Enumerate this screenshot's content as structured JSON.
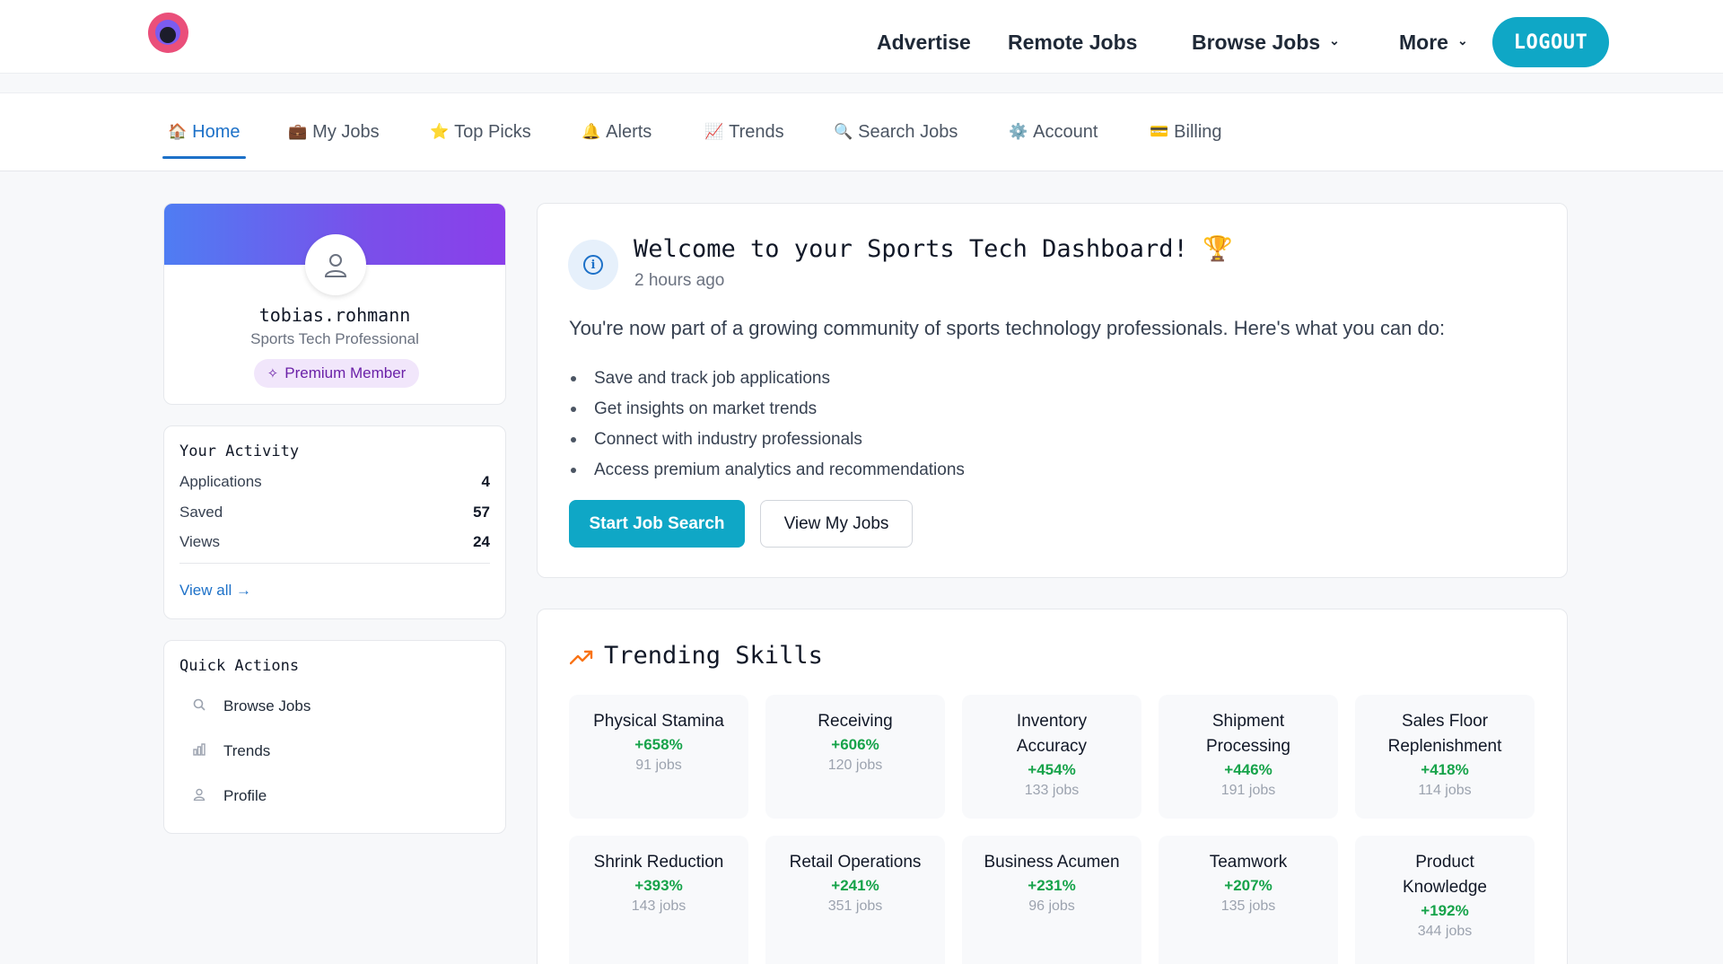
{
  "header": {
    "nav": [
      "Advertise",
      "Remote Jobs",
      "Browse Jobs",
      "More"
    ],
    "logout_label": "LOGOUT"
  },
  "tabs": [
    {
      "icon": "🏠",
      "label": "Home",
      "active": true
    },
    {
      "icon": "💼",
      "label": "My Jobs"
    },
    {
      "icon": "⭐",
      "label": "Top Picks"
    },
    {
      "icon": "🔔",
      "label": "Alerts"
    },
    {
      "icon": "📈",
      "label": "Trends"
    },
    {
      "icon": "🔍",
      "label": "Search Jobs"
    },
    {
      "icon": "⚙️",
      "label": "Account"
    },
    {
      "icon": "💳",
      "label": "Billing"
    }
  ],
  "profile": {
    "username": "tobias.rohmann",
    "role": "Sports Tech Professional",
    "badge": "Premium Member"
  },
  "activity": {
    "title": "Your Activity",
    "stats": [
      {
        "label": "Applications",
        "value": "4"
      },
      {
        "label": "Saved",
        "value": "57"
      },
      {
        "label": "Views",
        "value": "24"
      }
    ],
    "view_all": "View all →"
  },
  "quick_actions": {
    "title": "Quick Actions",
    "items": [
      "Browse Jobs",
      "Trends",
      "Profile"
    ]
  },
  "welcome": {
    "title": "Welcome to your Sports Tech Dashboard! 🏆",
    "time": "2 hours ago",
    "intro": "You're now part of a growing community of sports technology professionals. Here's what you can do:",
    "items": [
      "Save and track job applications",
      "Get insights on market trends",
      "Connect with industry professionals",
      "Access premium analytics and recommendations"
    ],
    "primary_button": "Start Job Search",
    "secondary_button": "View My Jobs"
  },
  "trending": {
    "title": "Trending Skills",
    "skills": [
      {
        "name": "Physical Stamina",
        "change": "+658%",
        "jobs": "91 jobs"
      },
      {
        "name": "Receiving",
        "change": "+606%",
        "jobs": "120 jobs"
      },
      {
        "name": "Inventory Accuracy",
        "change": "+454%",
        "jobs": "133 jobs"
      },
      {
        "name": "Shipment Processing",
        "change": "+446%",
        "jobs": "191 jobs"
      },
      {
        "name": "Sales Floor Replenishment",
        "change": "+418%",
        "jobs": "114 jobs"
      },
      {
        "name": "Shrink Reduction",
        "change": "+393%",
        "jobs": "143 jobs"
      },
      {
        "name": "Retail Operations",
        "change": "+241%",
        "jobs": "351 jobs"
      },
      {
        "name": "Business Acumen",
        "change": "+231%",
        "jobs": "96 jobs"
      },
      {
        "name": "Teamwork",
        "change": "+207%",
        "jobs": "135 jobs"
      },
      {
        "name": "Product Knowledge",
        "change": "+192%",
        "jobs": "344 jobs"
      }
    ]
  },
  "colors": {
    "accent": "#0fa7c6",
    "link": "#1d71c8",
    "positive": "#16a34a",
    "badge_bg": "#f1e6fb"
  }
}
